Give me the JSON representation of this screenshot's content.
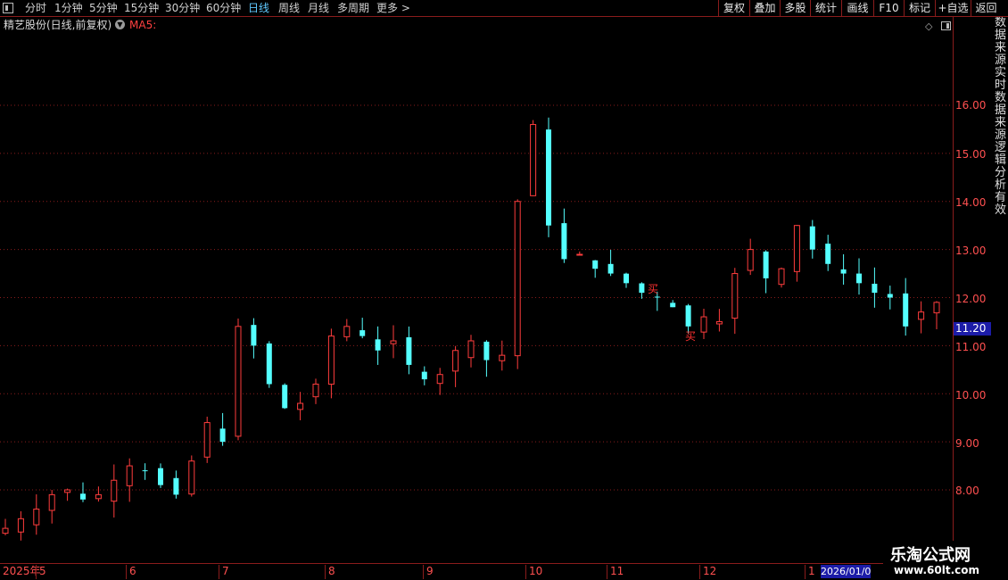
{
  "toolbar": {
    "left_items": [
      "分时",
      "1分钟",
      "5分钟",
      "15分钟",
      "30分钟",
      "60分钟",
      "日线",
      "周线",
      "月线",
      "多周期",
      "更多 >"
    ],
    "active": "日线",
    "right_items": [
      "复权",
      "叠加",
      "多股",
      "统计",
      "画线",
      "F10",
      "标记",
      "+自选",
      "返回"
    ]
  },
  "title_row": {
    "stock": "精艺股份(日线,前复权)",
    "ma_label": "MA5:"
  },
  "y_axis": {
    "ticks": [
      "16.00",
      "15.00",
      "14.00",
      "13.00",
      "12.00",
      "11.00",
      "10.00",
      "9.00",
      "8.00"
    ],
    "current_price": "11.20"
  },
  "x_axis": {
    "labels": [
      "2025年",
      "5",
      "6",
      "7",
      "8",
      "9",
      "10",
      "11",
      "12",
      "1"
    ],
    "date_box": "2026/01/0"
  },
  "signals": [
    "买",
    "买"
  ],
  "side_strip_text": "数据来源实时数据来源逻辑分析有效",
  "watermark": {
    "name": "乐淘公式网",
    "url": "www.60lt.com"
  },
  "colors": {
    "up": "#ff3d3d",
    "down": "#54ffff",
    "grid": "#8a1c1c"
  },
  "chart_data": {
    "type": "candlestick",
    "y_range": [
      7.0,
      17.5
    ],
    "x_range": [
      "2025-04",
      "2026-01"
    ],
    "close_approx": [
      7.2,
      7.4,
      7.6,
      7.9,
      8.0,
      7.8,
      7.9,
      8.2,
      8.5,
      8.4,
      8.1,
      7.9,
      8.6,
      9.4,
      9.0,
      11.4,
      11.0,
      10.2,
      9.7,
      9.8,
      10.2,
      11.2,
      11.4,
      11.2,
      10.9,
      11.1,
      10.6,
      10.3,
      10.4,
      10.9,
      11.1,
      10.7,
      10.8,
      14.0,
      15.6,
      13.5,
      12.8,
      12.9,
      12.6,
      12.5,
      12.3,
      12.1,
      12.0,
      11.8,
      11.4,
      11.6,
      11.5,
      12.5,
      13.0,
      12.4,
      12.6,
      13.5,
      13.0,
      12.7,
      12.5,
      12.3,
      12.1,
      12.0,
      11.4,
      11.7,
      11.9
    ]
  }
}
